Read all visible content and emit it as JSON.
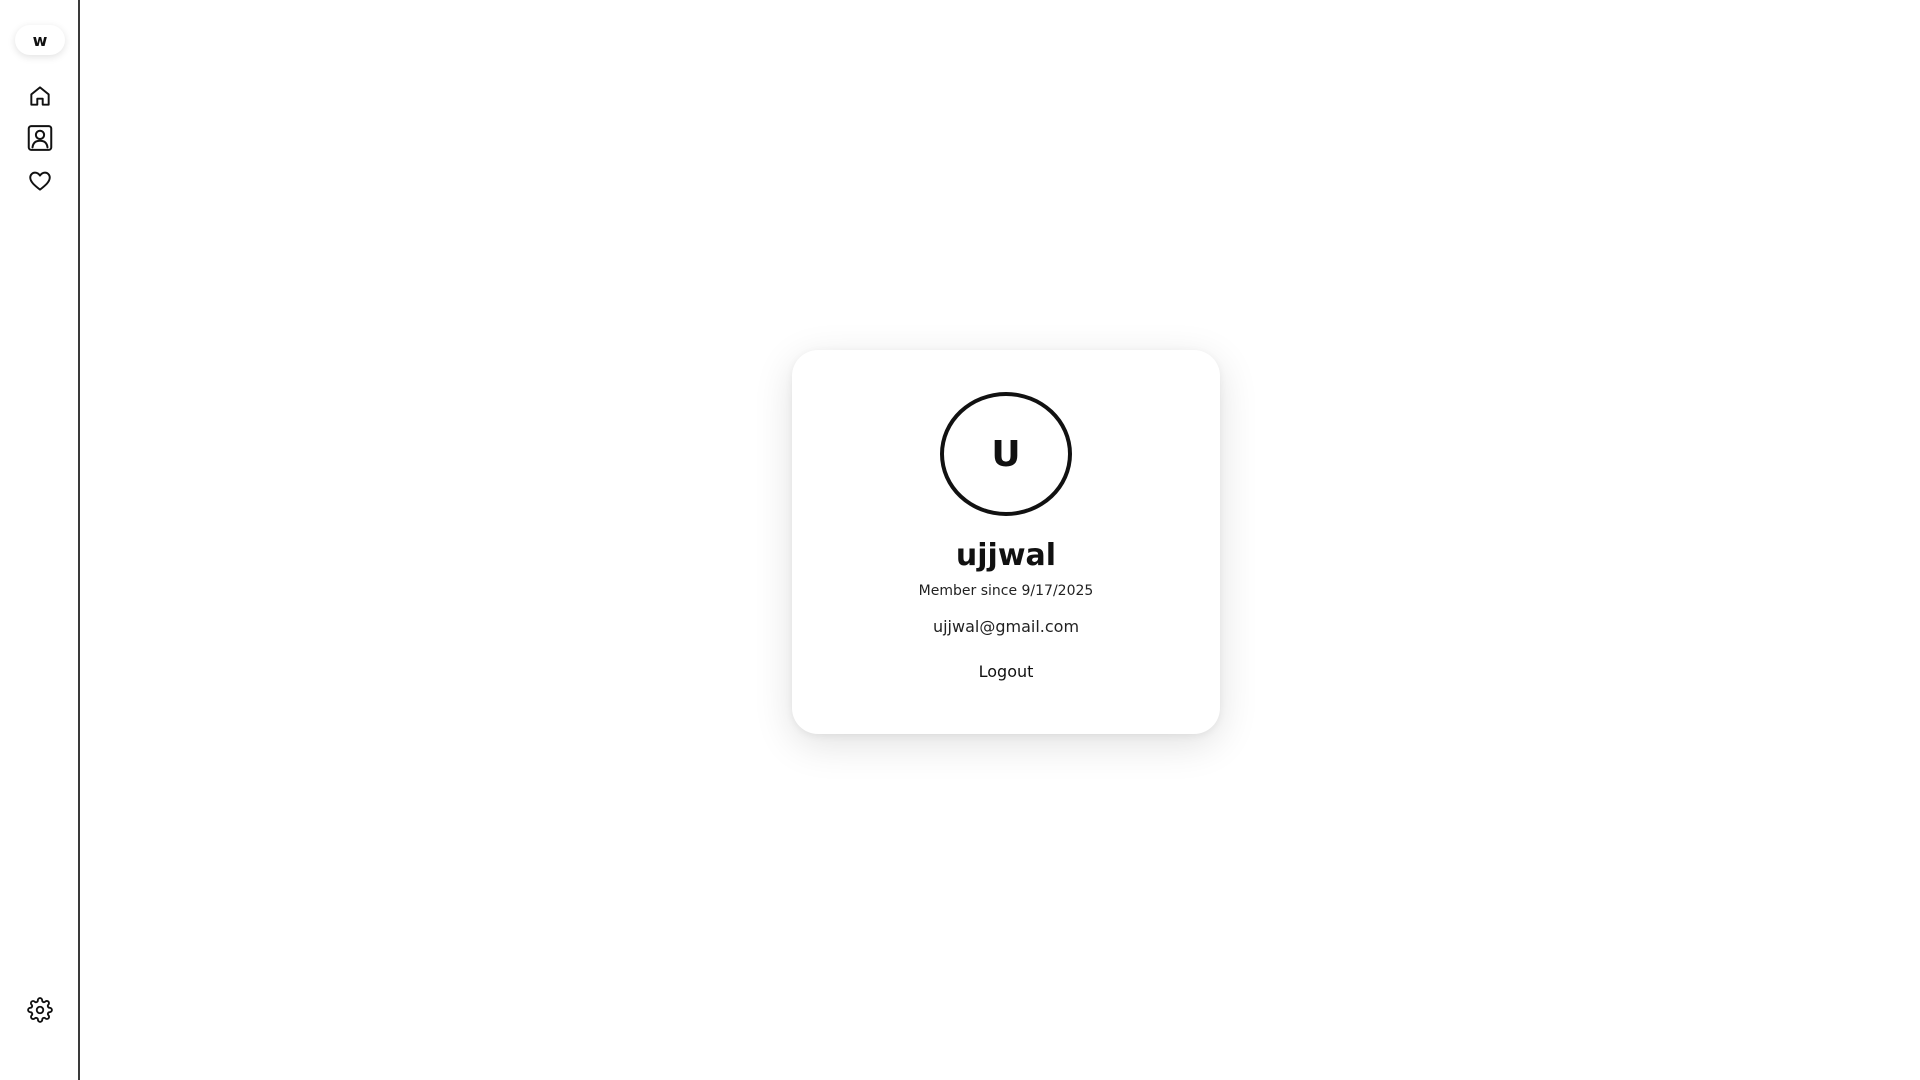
{
  "sidebar": {
    "logo_text": "w",
    "items": [
      {
        "icon": "home-icon"
      },
      {
        "icon": "profile-icon"
      },
      {
        "icon": "heart-icon"
      }
    ],
    "settings": {
      "icon": "gear-icon"
    }
  },
  "profile": {
    "avatar_initial": "U",
    "username": "ujjwal",
    "member_since": "Member since 9/17/2025",
    "email": "ujjwal@gmail.com",
    "logout_label": "Logout"
  }
}
